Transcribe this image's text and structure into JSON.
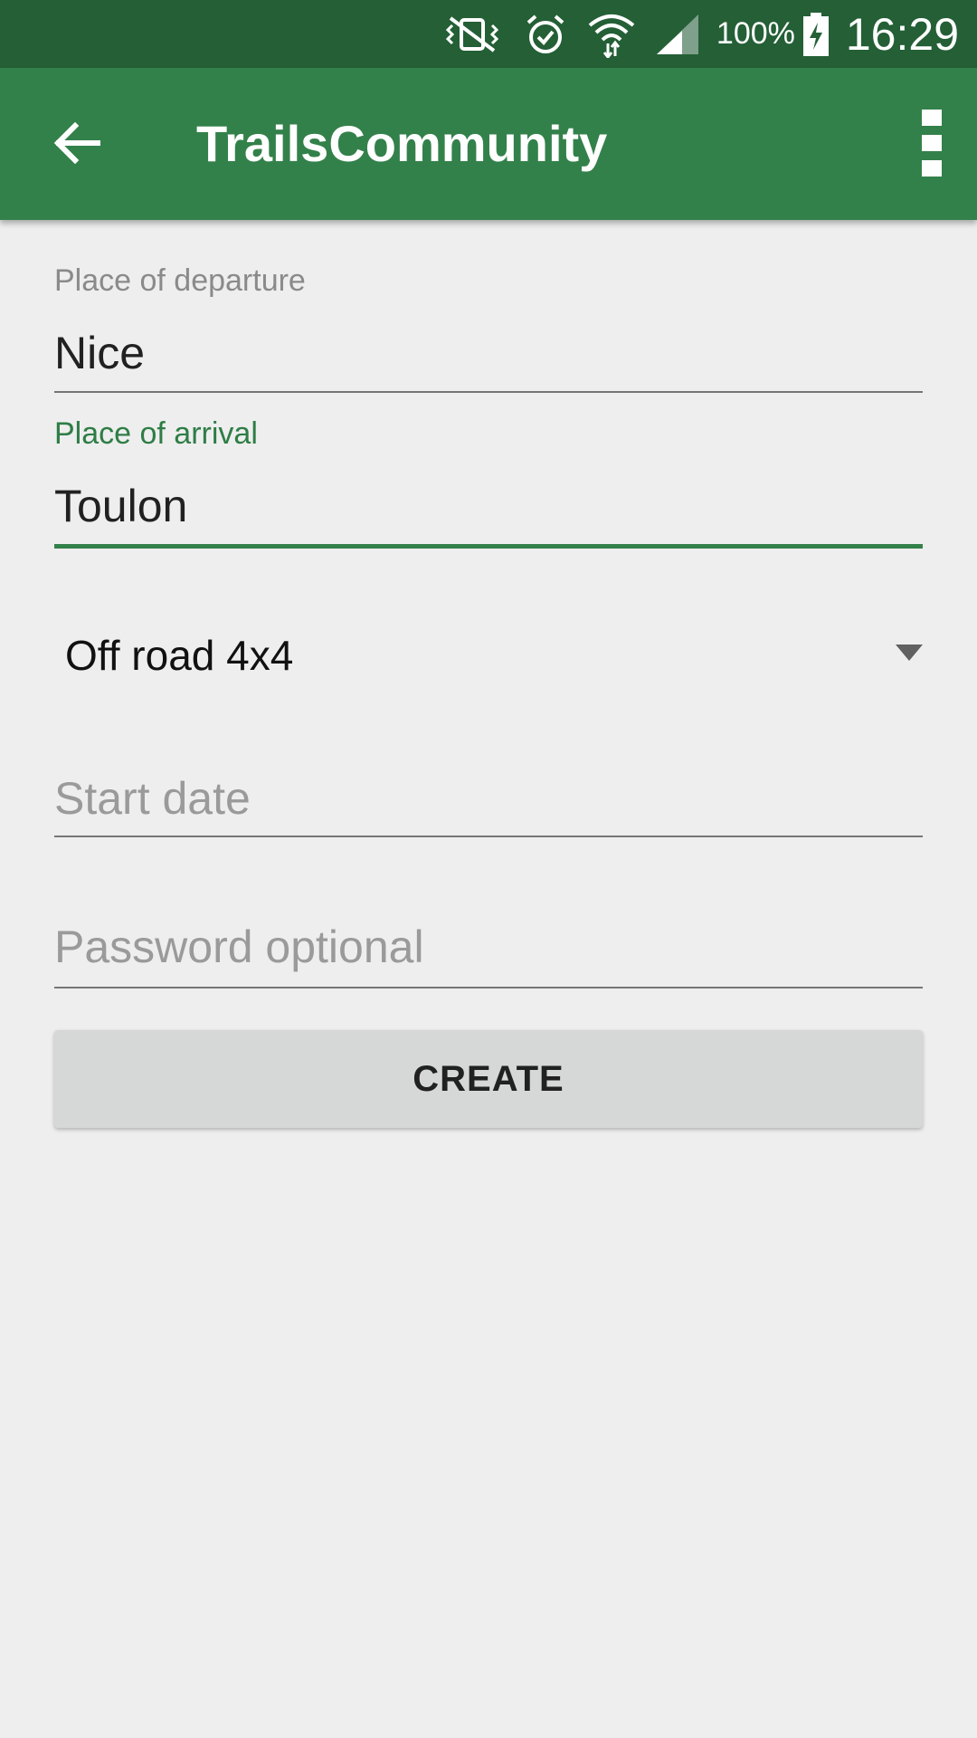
{
  "status_bar": {
    "battery_percent": "100%",
    "time": "16:29",
    "icons": [
      "vibrate-mute-icon",
      "alarm-icon",
      "wifi-icon",
      "signal-icon",
      "battery-charging-icon"
    ]
  },
  "app_bar": {
    "title": "TrailsCommunity",
    "back_icon": "arrow-back-icon",
    "menu_icon": "more-vert-icon",
    "background": "#33814A"
  },
  "form": {
    "departure": {
      "label": "Place of departure",
      "value": "Nice"
    },
    "arrival": {
      "label": "Place of arrival",
      "value": "Toulon",
      "focused": true
    },
    "vehicle_type": {
      "selected": "Off road 4x4"
    },
    "start_date": {
      "placeholder": "Start date",
      "value": ""
    },
    "password": {
      "placeholder": "Password optional",
      "value": ""
    },
    "create_label": "CREATE"
  },
  "colors": {
    "status_bar": "#245F36",
    "accent": "#33814A",
    "background": "#EEEEEE"
  }
}
